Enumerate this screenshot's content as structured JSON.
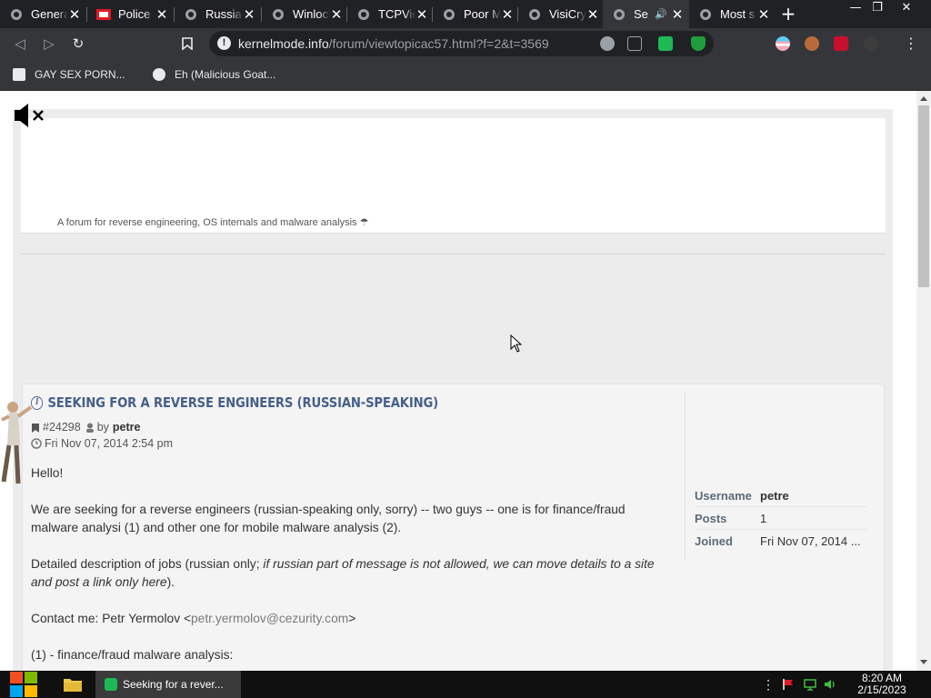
{
  "tabs": [
    {
      "title": "General",
      "icon": "globe-icon"
    },
    {
      "title": "Police",
      "icon": "flag-icon"
    },
    {
      "title": "Russian",
      "icon": "globe-icon"
    },
    {
      "title": "Winlock",
      "icon": "globe-icon"
    },
    {
      "title": "TCPView",
      "icon": "globe-icon"
    },
    {
      "title": "Poor M",
      "icon": "globe-icon"
    },
    {
      "title": "VisiCry",
      "icon": "globe-icon"
    },
    {
      "title": "Se",
      "icon": "globe-icon",
      "active": true,
      "audio": true
    },
    {
      "title": "Most s",
      "icon": "globe-icon"
    }
  ],
  "close_glyph": "✕",
  "new_tab_glyph": "+",
  "window": {
    "minimize": "—",
    "restore": "❐",
    "close": "✕"
  },
  "toolbar": {
    "back": "◁",
    "forward": "▷",
    "reload": "↻",
    "bookmark": "🔖",
    "url_host": "kernelmode.info",
    "url_path": "/forum/viewtopicac57.html?f=2&t=3569",
    "menu": "⋮"
  },
  "bookmarks": [
    {
      "label": "GAY SEX PORN...",
      "icon": "bookmark-icon"
    },
    {
      "label": "Eh (Malicious Goat...",
      "icon": "globe-icon"
    }
  ],
  "site": {
    "tagline": "A forum for reverse engineering, OS internals and malware analysis",
    "mute_glyph": "✕"
  },
  "post": {
    "title": "Seeking for a reverse engineers (russian-speaking)",
    "id": "#24298",
    "by": "by",
    "author": "petre",
    "date": "Fri Nov 07, 2014 2:54 pm",
    "p1": "Hello!",
    "p2": "We are seeking for a reverse engineers (russian-speaking only, sorry) -- two guys -- one is for finance/fraud malware analysi (1) and other one for mobile malware analysis (2).",
    "p3_a": "Detailed description of jobs (russian only; ",
    "p3_em": "if russian part of message is not allowed, we can move details to a site and post a link only here",
    "p3_b": ").",
    "p4_a": "Contact me: Petr Yermolov <",
    "p4_mail": "petr.yermolov@cezurity.com",
    "p4_b": ">",
    "p5": "(1) - finance/fraud malware analysis:"
  },
  "profile": [
    {
      "key": "Username",
      "value": "petre",
      "bold": true
    },
    {
      "key": "Posts",
      "value": "1"
    },
    {
      "key": "Joined",
      "value": "Fri Nov 07, 2014 ..."
    }
  ],
  "taskbar": {
    "active_title": "Seeking for a rever...",
    "time": "8:20 AM",
    "date": "2/15/2023"
  },
  "colors": {
    "accent_link": "#47608a",
    "browser_bg": "#202124",
    "toolbar_bg": "#35363a"
  }
}
